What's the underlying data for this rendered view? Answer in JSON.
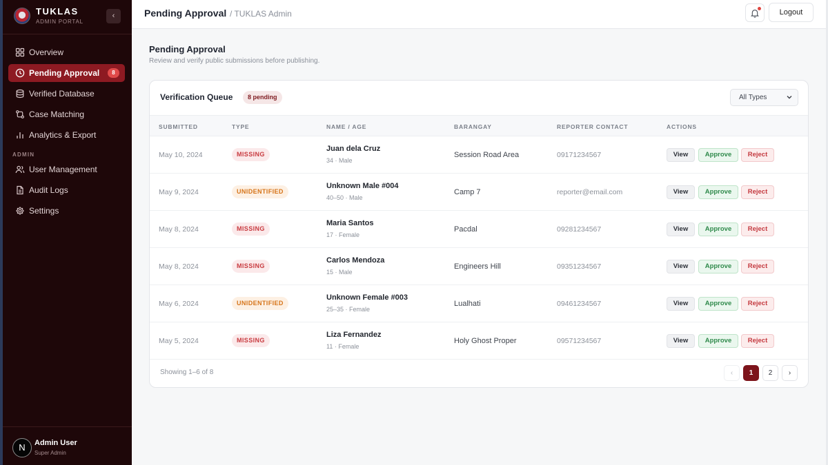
{
  "brand": {
    "name": "TUKLAS",
    "subtitle": "ADMIN PORTAL"
  },
  "sidebar": {
    "collapse_icon": "chevron-left-icon",
    "items": [
      {
        "label": "Overview",
        "icon": "grid-icon"
      },
      {
        "label": "Pending Approval",
        "icon": "clock-icon",
        "badge": "8",
        "active": true
      },
      {
        "label": "Verified Database",
        "icon": "database-icon"
      },
      {
        "label": "Case Matching",
        "icon": "git-compare-icon"
      },
      {
        "label": "Analytics & Export",
        "icon": "bar-chart-icon"
      }
    ],
    "admin_section_label": "ADMIN",
    "admin_items": [
      {
        "label": "User Management",
        "icon": "users-icon"
      },
      {
        "label": "Audit Logs",
        "icon": "file-text-icon"
      },
      {
        "label": "Settings",
        "icon": "gear-icon"
      }
    ],
    "user": {
      "initial": "N",
      "name": "Admin User",
      "role": "Super Admin"
    }
  },
  "topbar": {
    "title": "Pending Approval",
    "breadcrumb": "/ TUKLAS Admin",
    "logout_label": "Logout"
  },
  "page": {
    "heading": "Pending Approval",
    "subheading": "Review and verify public submissions before publishing."
  },
  "queue": {
    "title": "Verification Queue",
    "pending_badge": "8 pending",
    "filter": {
      "selected": "All Types"
    },
    "columns": [
      "SUBMITTED",
      "TYPE",
      "NAME / AGE",
      "BARANGAY",
      "REPORTER CONTACT",
      "ACTIONS"
    ],
    "actions": {
      "view": "View",
      "approve": "Approve",
      "reject": "Reject"
    },
    "rows": [
      {
        "submitted": "May 10, 2024",
        "type": "MISSING",
        "type_kind": "missing",
        "name": "Juan dela Cruz",
        "meta": "34 · Male",
        "barangay": "Session Road Area",
        "contact": "09171234567"
      },
      {
        "submitted": "May 9, 2024",
        "type": "UNIDENTIFIED",
        "type_kind": "unidentified",
        "name": "Unknown Male #004",
        "meta": "40–50 · Male",
        "barangay": "Camp 7",
        "contact": "reporter@email.com"
      },
      {
        "submitted": "May 8, 2024",
        "type": "MISSING",
        "type_kind": "missing",
        "name": "Maria Santos",
        "meta": "17 · Female",
        "barangay": "Pacdal",
        "contact": "09281234567"
      },
      {
        "submitted": "May 8, 2024",
        "type": "MISSING",
        "type_kind": "missing",
        "name": "Carlos Mendoza",
        "meta": "15 · Male",
        "barangay": "Engineers Hill",
        "contact": "09351234567"
      },
      {
        "submitted": "May 6, 2024",
        "type": "UNIDENTIFIED",
        "type_kind": "unidentified",
        "name": "Unknown Female #003",
        "meta": "25–35 · Female",
        "barangay": "Lualhati",
        "contact": "09461234567"
      },
      {
        "submitted": "May 5, 2024",
        "type": "MISSING",
        "type_kind": "missing",
        "name": "Liza Fernandez",
        "meta": "11 · Female",
        "barangay": "Holy Ghost Proper",
        "contact": "09571234567"
      }
    ],
    "showing": "Showing 1–6 of 8",
    "pagination": {
      "prev": "‹",
      "pages": [
        "1",
        "2"
      ],
      "current": "1",
      "next": "›"
    }
  },
  "colors": {
    "sidebar_bg": "#1e0709",
    "accent": "#8d1a22",
    "missing": "#c83a3f",
    "unidentified": "#d67419",
    "approve": "#2f8a4b"
  }
}
